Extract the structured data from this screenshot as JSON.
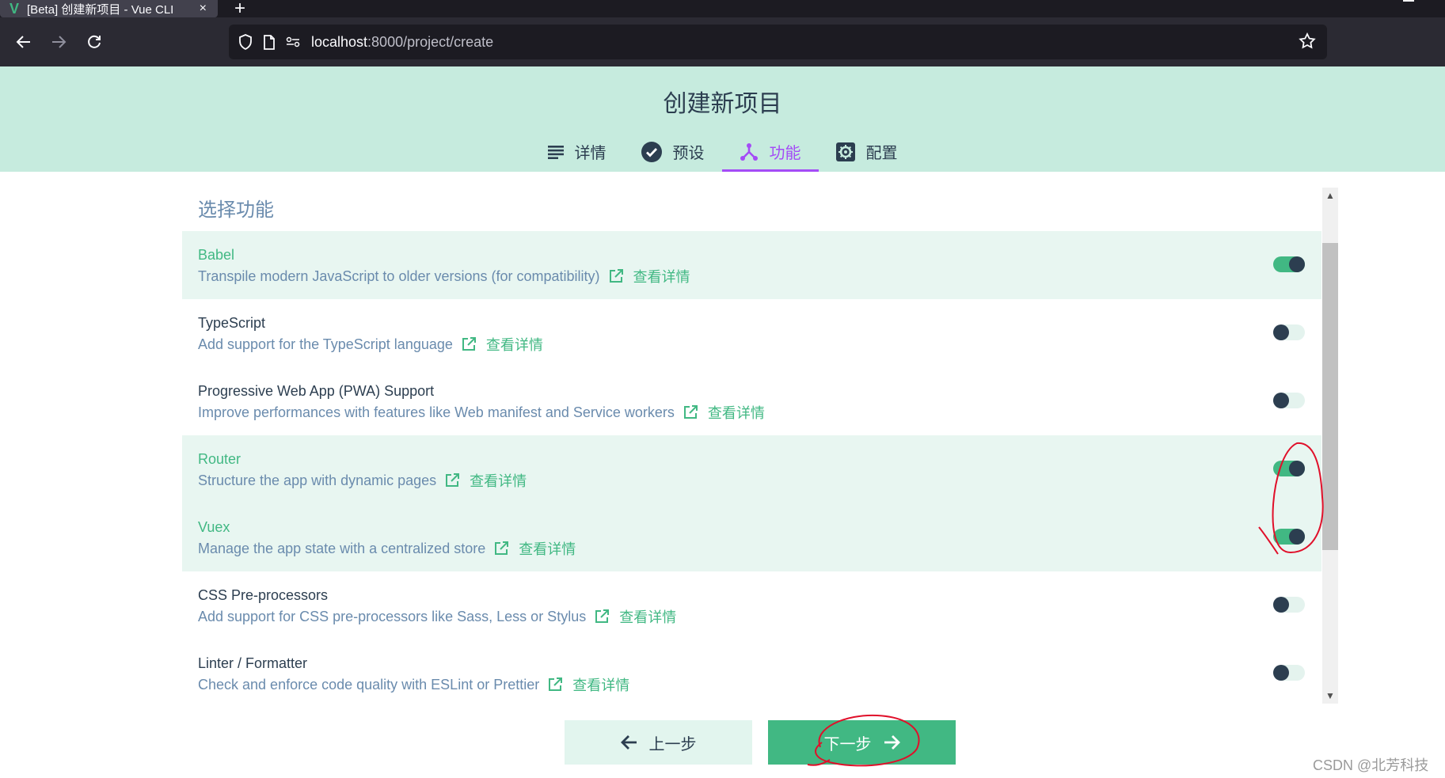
{
  "browser": {
    "tab_title": "[Beta] 创建新项目 - Vue CLI",
    "tab_close": "×",
    "new_tab": "+",
    "url_host": "localhost",
    "url_rest": ":8000/project/create"
  },
  "header": {
    "title": "创建新项目",
    "tabs": [
      {
        "label": "详情",
        "icon": "list-icon"
      },
      {
        "label": "预设",
        "icon": "check-circle-icon"
      },
      {
        "label": "功能",
        "icon": "fork-icon"
      },
      {
        "label": "配置",
        "icon": "gear-icon"
      }
    ],
    "active_tab": "功能"
  },
  "content": {
    "section_title": "选择功能",
    "link_label": "查看详情",
    "features": [
      {
        "name": "Babel",
        "description": "Transpile modern JavaScript to older versions (for compatibility)",
        "enabled": true
      },
      {
        "name": "TypeScript",
        "description": "Add support for the TypeScript language",
        "enabled": false
      },
      {
        "name": "Progressive Web App (PWA) Support",
        "description": "Improve performances with features like Web manifest and Service workers",
        "enabled": false
      },
      {
        "name": "Router",
        "description": "Structure the app with dynamic pages",
        "enabled": true
      },
      {
        "name": "Vuex",
        "description": "Manage the app state with a centralized store",
        "enabled": true
      },
      {
        "name": "CSS Pre-processors",
        "description": "Add support for CSS pre-processors like Sass, Less or Stylus",
        "enabled": false
      },
      {
        "name": "Linter / Formatter",
        "description": "Check and enforce code quality with ESLint or Prettier",
        "enabled": false
      }
    ]
  },
  "footer": {
    "prev_label": "上一步",
    "next_label": "下一步"
  },
  "watermark": "CSDN @北芳科技",
  "colors": {
    "accent": "#41b883",
    "active_tab": "#a44cf6",
    "header_bg": "#c6ebde",
    "text": "#2c3e50",
    "muted": "#6a8bad",
    "annotation": "#e0102a"
  }
}
